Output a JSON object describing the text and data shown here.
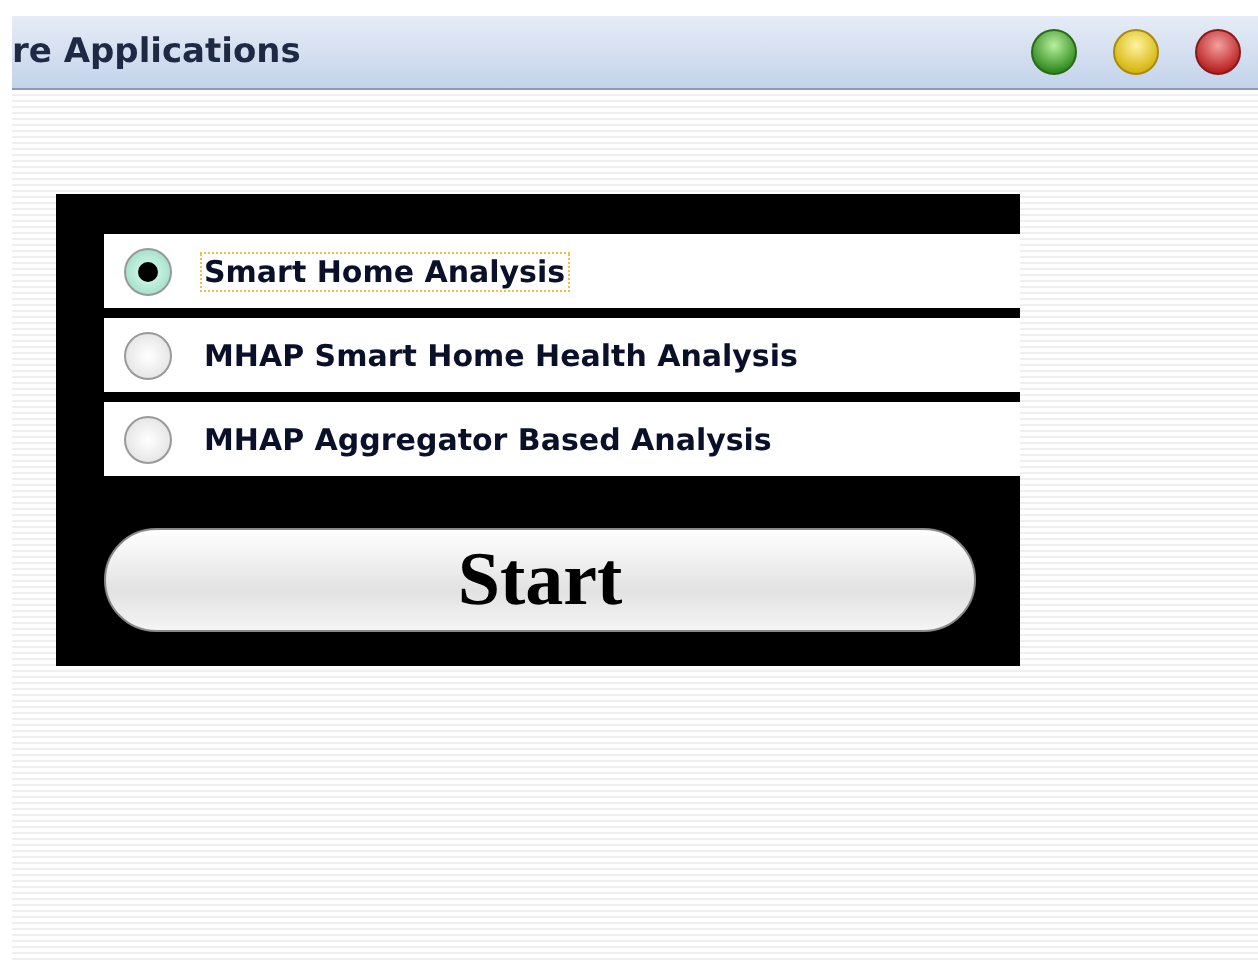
{
  "window": {
    "title": "re Applications"
  },
  "options": [
    {
      "label": "Smart Home Analysis",
      "selected": true
    },
    {
      "label": "MHAP Smart Home Health Analysis",
      "selected": false
    },
    {
      "label": "MHAP Aggregator Based Analysis",
      "selected": false
    }
  ],
  "start_button": {
    "label": "Start"
  }
}
